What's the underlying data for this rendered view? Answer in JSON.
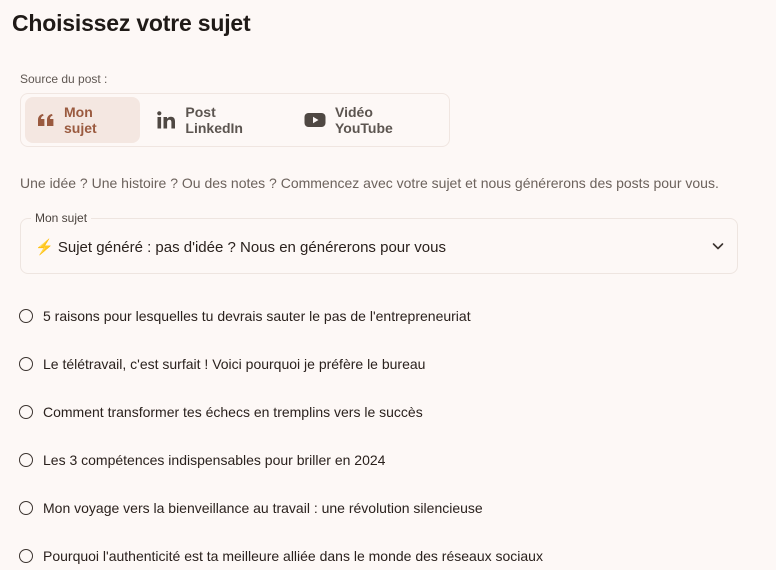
{
  "header": {
    "title": "Choisissez votre sujet"
  },
  "source": {
    "label": "Source du post :",
    "tabs": [
      {
        "label": "Mon sujet",
        "icon": "quote-icon",
        "active": true
      },
      {
        "label": "Post LinkedIn",
        "icon": "linkedin-icon",
        "active": false
      },
      {
        "label": "Vidéo YouTube",
        "icon": "youtube-icon",
        "active": false
      }
    ]
  },
  "description": "Une idée ? Une histoire ? Ou des notes ? Commencez avec votre sujet et nous générerons des posts pour vous.",
  "subject_select": {
    "legend": "Mon sujet",
    "value": "⚡ Sujet généré : pas d'idée ? Nous en générerons pour vous",
    "icon": "chevron-down-icon"
  },
  "topics": [
    {
      "label": "5 raisons pour lesquelles tu devrais sauter le pas de l'entrepreneuriat",
      "selected": false
    },
    {
      "label": "Le télétravail, c'est surfait ! Voici pourquoi je préfère le bureau",
      "selected": false
    },
    {
      "label": "Comment transformer tes échecs en tremplins vers le succès",
      "selected": false
    },
    {
      "label": "Les 3 compétences indispensables pour briller en 2024",
      "selected": false
    },
    {
      "label": "Mon voyage vers la bienveillance au travail : une révolution silencieuse",
      "selected": false
    },
    {
      "label": "Pourquoi l'authenticité est ta meilleure alliée dans le monde des réseaux sociaux",
      "selected": false
    }
  ],
  "colors": {
    "background": "#fdf8f6",
    "accent": "#9a5a3f",
    "active_tab_bg": "#f4e7e1"
  }
}
